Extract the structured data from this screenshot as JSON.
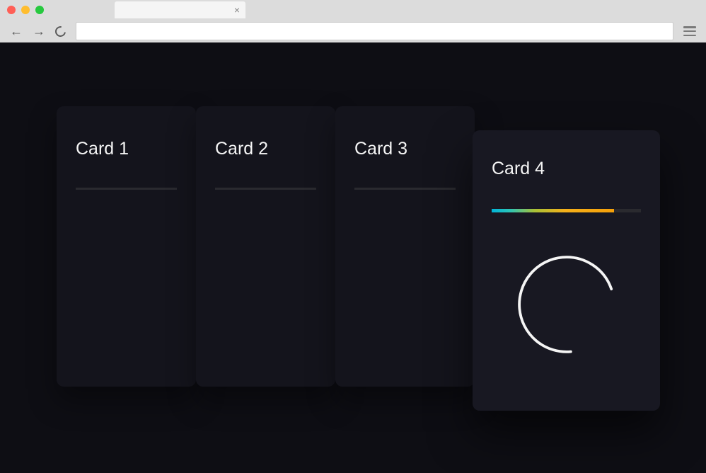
{
  "browser": {
    "tab_close": "×"
  },
  "cards": [
    {
      "title": "Card 1"
    },
    {
      "title": "Card 2"
    },
    {
      "title": "Card 3"
    },
    {
      "title": "Card 4",
      "progress_percent": 82
    }
  ],
  "colors": {
    "page_bg": "#0e0e14",
    "card_bg": "#14141c",
    "card_elevated_bg": "#181822",
    "progress_gradient_start": "#00b4d8",
    "progress_gradient_end": "#f5a00a"
  }
}
